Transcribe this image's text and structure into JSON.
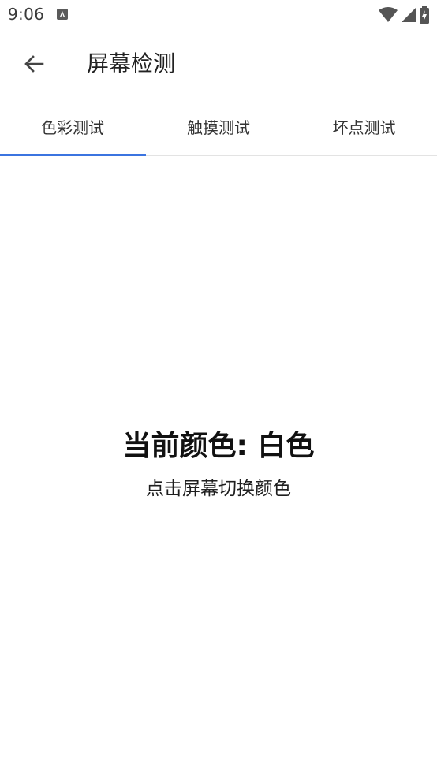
{
  "status_bar": {
    "time": "9:06",
    "icons": [
      "notification-icon",
      "wifi-icon",
      "signal-icon",
      "battery-charging-icon"
    ]
  },
  "app_bar": {
    "back_icon": "arrow-back-icon",
    "title": "屏幕检测"
  },
  "tabs": [
    {
      "label": "色彩测试",
      "selected": true
    },
    {
      "label": "触摸测试",
      "selected": false
    },
    {
      "label": "坏点测试",
      "selected": false
    }
  ],
  "main": {
    "current_color": "当前颜色: 白色",
    "hint": "点击屏幕切换颜色"
  },
  "colors": {
    "accent": "#3b74e0",
    "background": "#ffffff",
    "text_primary": "#111111"
  }
}
